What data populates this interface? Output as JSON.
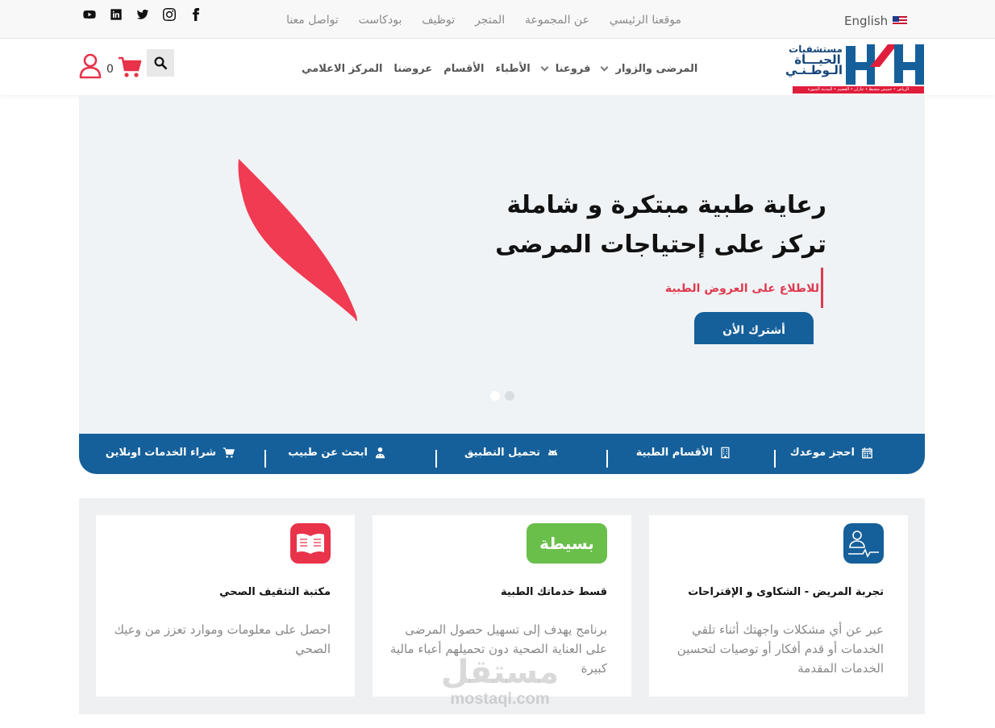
{
  "topbar": {
    "social": [
      {
        "name": "facebook-icon"
      },
      {
        "name": "instagram-icon"
      },
      {
        "name": "twitter-icon"
      },
      {
        "name": "linkedin-icon"
      },
      {
        "name": "youtube-icon"
      }
    ],
    "nav": [
      "موقعنا الرئيسي",
      "عن المجموعة",
      "المتجر",
      "توظيف",
      "بودكاست",
      "تواصل معنا"
    ],
    "language": "English"
  },
  "logo": {
    "line1": "مستشفيات",
    "line2": "الحيـــاة",
    "line3": "الـوطـنـي",
    "tagline": "الرياض • خميس مشيط • جازان • القصيم • المدينة المنورة",
    "brand_colors": {
      "blue": "#15609a",
      "red": "#e01e3c"
    }
  },
  "mainnav": {
    "items": [
      {
        "label": "المرضى والزوار",
        "dropdown": true
      },
      {
        "label": "فروعنا",
        "dropdown": true
      },
      {
        "label": "الأطباء",
        "dropdown": false
      },
      {
        "label": "الأقسام",
        "dropdown": false
      },
      {
        "label": "عروضنا",
        "dropdown": false
      },
      {
        "label": "المركز الاعلامي",
        "dropdown": false
      }
    ],
    "cart_count": "0"
  },
  "hero": {
    "title_line1": "رعاية طبية مبتكرة و شاملة",
    "title_line2": "تركز على إحتياجات المرضى",
    "subtitle": "للاطلاع على العروض الطبية",
    "button": "أشترك الأن",
    "slides": 2,
    "active_slide": 1,
    "accent_color": "#f03b52"
  },
  "quicklinks": [
    {
      "label": "احجز موعدك",
      "icon": "calendar-icon"
    },
    {
      "label": "الأقسام الطبية",
      "icon": "building-icon"
    },
    {
      "label": "تحميل التطبيق",
      "icon": "android-icon"
    },
    {
      "label": "ابحث عن طبيب",
      "icon": "doctor-icon"
    },
    {
      "label": "شراء الخدمات اونلاين",
      "icon": "cart-icon"
    }
  ],
  "cards": [
    {
      "title": "تجربة المريض - الشكاوى و الإقتراحات",
      "text": "عبر عن أي مشكلات واجهتك أثناء تلقي الخدمات أو قدم أفكار أو توصيات لتحسين الخدمات المقدمة",
      "icon": "patient-feedback-icon",
      "icon_color": "#15609a"
    },
    {
      "title": "قسط خدماتك الطبية",
      "text": "برنامج يهدف إلى تسهيل حصول المرضى على العناية الصحية دون تحميلهم أعباء مالية كبيرة",
      "icon": "basita-logo-icon",
      "icon_label": "بسيطة",
      "icon_color": "#6abf4b"
    },
    {
      "title": "مكتبة التثقيف الصحي",
      "text": "احصل على معلومات وموارد تعزز من وعيك الصحي",
      "icon": "open-book-icon",
      "icon_color": "#e8334a"
    }
  ],
  "watermark": {
    "arabic": "مستقل",
    "latin": "mostaql.com"
  }
}
